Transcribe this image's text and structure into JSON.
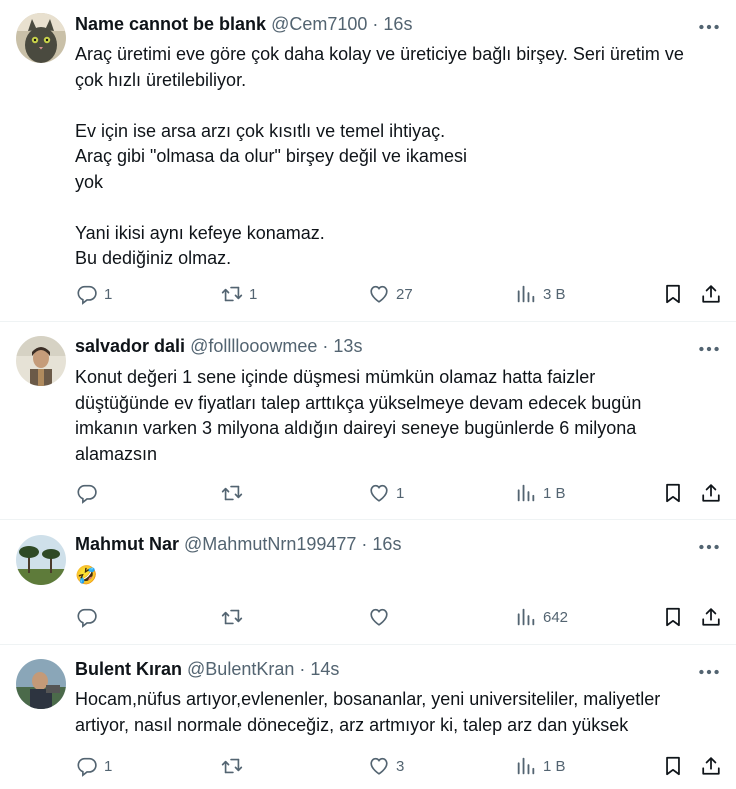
{
  "tweets": [
    {
      "name": "Name cannot be blank",
      "handle": "@Cem7100",
      "time": "· 16s",
      "text": "Araç üretimi eve göre çok daha kolay ve üreticiye bağlı birşey. Seri üretim ve\nçok hızlı üretilebiliyor.\n\nEv için ise arsa arzı çok kısıtlı ve temel ihtiyaç.\nAraç gibi \"olmasa da olur\" birşey değil ve ikamesi\nyok\n\nYani ikisi aynı kefeye konamaz.\nBu dediğiniz olmaz.",
      "replies": "1",
      "retweets": "1",
      "likes": "27",
      "views": "3 B"
    },
    {
      "name": "salvador dali",
      "handle": "@follllooowmee",
      "time": "· 13s",
      "text": "Konut değeri 1 sene içinde düşmesi mümkün olamaz hatta faizler\ndüştüğünde ev fiyatları talep arttıkça yükselmeye devam edecek bugün\nimkanın varken 3 milyona aldığın daireyi seneye bugünlerde 6 milyona\nalamazsın",
      "replies": "",
      "retweets": "",
      "likes": "1",
      "views": "1 B"
    },
    {
      "name": "Mahmut Nar",
      "handle": "@MahmutNrn199477",
      "time": "· 16s",
      "text": "🤣",
      "replies": "",
      "retweets": "",
      "likes": "",
      "views": "642"
    },
    {
      "name": "Bulent Kıran",
      "handle": "@BulentKran",
      "time": "· 14s",
      "text": "Hocam,nüfus artıyor,evlenenler, bosananlar, yeni universiteliler, maliyetler\nartiyor, nasıl normale döneceğiz, arz artmıyor ki, talep arz dan yüksek",
      "replies": "1",
      "retweets": "",
      "likes": "3",
      "views": "1 B"
    }
  ],
  "icons": {
    "more": "more-horizontal-icon",
    "reply": "reply-bubble-icon",
    "retweet": "retweet-icon",
    "like": "heart-icon",
    "views": "views-bar-chart-icon",
    "bookmark": "bookmark-icon",
    "share": "share-upload-icon"
  },
  "colors": {
    "text": "#0f1419",
    "muted": "#536471",
    "divider": "#eff3f4"
  }
}
